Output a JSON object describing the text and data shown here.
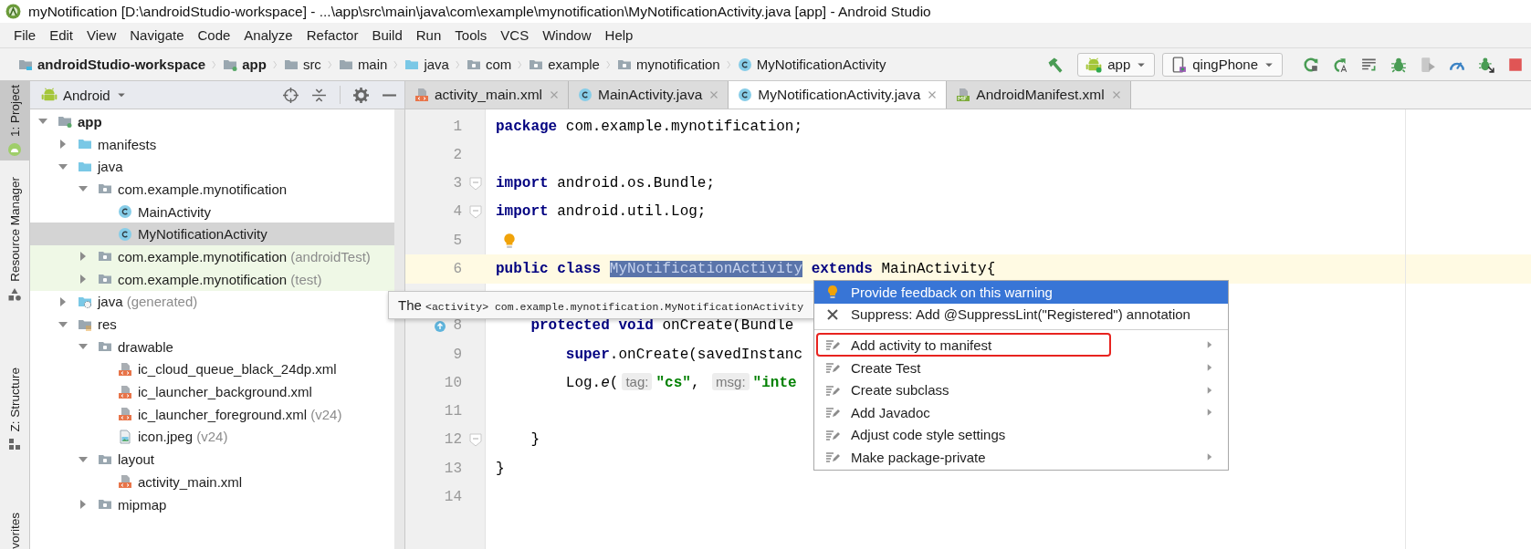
{
  "window": {
    "title": "myNotification [D:\\androidStudio-workspace] - ...\\app\\src\\main\\java\\com\\example\\mynotification\\MyNotificationActivity.java [app] - Android Studio"
  },
  "menu_bar": [
    "File",
    "Edit",
    "View",
    "Navigate",
    "Code",
    "Analyze",
    "Refactor",
    "Build",
    "Run",
    "Tools",
    "VCS",
    "Window",
    "Help"
  ],
  "breadcrumbs": [
    {
      "label": "androidStudio-workspace",
      "kind": "project"
    },
    {
      "label": "app",
      "kind": "module"
    },
    {
      "label": "src",
      "kind": "folder"
    },
    {
      "label": "main",
      "kind": "folder"
    },
    {
      "label": "java",
      "kind": "source"
    },
    {
      "label": "com",
      "kind": "package"
    },
    {
      "label": "example",
      "kind": "package"
    },
    {
      "label": "mynotification",
      "kind": "package"
    },
    {
      "label": "MyNotificationActivity",
      "kind": "class"
    }
  ],
  "run_config": {
    "label": "app"
  },
  "device": {
    "label": "qingPhone"
  },
  "tool_strip": [
    {
      "label": "1: Project",
      "kind": "android",
      "selected": true
    },
    {
      "label": "Resource Manager",
      "kind": "shapes",
      "selected": false
    },
    {
      "label": "Z: Structure",
      "kind": "structure",
      "selected": false
    },
    {
      "label": "vorites",
      "kind": "none",
      "selected": false
    }
  ],
  "project_panel": {
    "view": "Android",
    "tree": [
      {
        "label": "app",
        "kind": "module",
        "expanded": true,
        "selected": false,
        "test": false,
        "children": [
          {
            "label": "manifests",
            "kind": "source",
            "expanded": false,
            "selected": false,
            "test": false
          },
          {
            "label": "java",
            "kind": "source",
            "expanded": true,
            "selected": false,
            "test": false,
            "children": [
              {
                "label": "com.example.mynotification",
                "kind": "package",
                "expanded": true,
                "selected": false,
                "test": false,
                "children": [
                  {
                    "label": "MainActivity",
                    "kind": "class",
                    "selected": false,
                    "test": false
                  },
                  {
                    "label": "MyNotificationActivity",
                    "kind": "class",
                    "selected": true,
                    "test": false
                  }
                ]
              },
              {
                "label": "com.example.mynotification",
                "suffix": "(androidTest)",
                "kind": "package",
                "expanded": false,
                "selected": false,
                "test": true
              },
              {
                "label": "com.example.mynotification",
                "suffix": "(test)",
                "kind": "package",
                "expanded": false,
                "selected": false,
                "test": true
              }
            ]
          },
          {
            "label": "java",
            "suffix": "(generated)",
            "kind": "generated",
            "expanded": false,
            "selected": false,
            "test": false
          },
          {
            "label": "res",
            "kind": "res",
            "expanded": true,
            "selected": false,
            "test": false,
            "children": [
              {
                "label": "drawable",
                "kind": "package",
                "expanded": true,
                "selected": false,
                "test": false,
                "children": [
                  {
                    "label": "ic_cloud_queue_black_24dp.xml",
                    "kind": "xml",
                    "selected": false,
                    "test": false
                  },
                  {
                    "label": "ic_launcher_background.xml",
                    "kind": "xml",
                    "selected": false,
                    "test": false
                  },
                  {
                    "label": "ic_launcher_foreground.xml",
                    "suffix": "(v24)",
                    "kind": "xml",
                    "selected": false,
                    "test": false
                  },
                  {
                    "label": "icon.jpeg",
                    "suffix": "(v24)",
                    "kind": "image",
                    "selected": false,
                    "test": false
                  }
                ]
              },
              {
                "label": "layout",
                "kind": "package",
                "expanded": true,
                "selected": false,
                "test": false,
                "children": [
                  {
                    "label": "activity_main.xml",
                    "kind": "xml",
                    "selected": false,
                    "test": false
                  }
                ]
              },
              {
                "label": "mipmap",
                "kind": "package",
                "expanded": false,
                "selected": false,
                "test": false
              }
            ]
          }
        ]
      }
    ]
  },
  "editor": {
    "tabs": [
      {
        "label": "activity_main.xml",
        "kind": "xml",
        "selected": false
      },
      {
        "label": "MainActivity.java",
        "kind": "class",
        "selected": false
      },
      {
        "label": "MyNotificationActivity.java",
        "kind": "class",
        "selected": true
      },
      {
        "label": "AndroidManifest.xml",
        "kind": "manifest",
        "selected": false
      }
    ],
    "lines": [
      {
        "number": "1",
        "kind": "code",
        "current": false,
        "fold": false,
        "tokens": [
          {
            "text": "package",
            "kind": "keyword"
          },
          {
            "text": " com.example.mynotification;",
            "kind": "plain"
          }
        ]
      },
      {
        "number": "2",
        "kind": "code",
        "current": false,
        "fold": false
      },
      {
        "number": "3",
        "kind": "code",
        "current": false,
        "fold": true,
        "tokens": [
          {
            "text": "import",
            "kind": "keyword"
          },
          {
            "text": " android.os.Bundle;",
            "kind": "plain"
          }
        ]
      },
      {
        "number": "4",
        "kind": "code",
        "current": false,
        "fold": true,
        "tokens": [
          {
            "text": "import",
            "kind": "keyword"
          },
          {
            "text": " android.util.Log;",
            "kind": "plain"
          }
        ]
      },
      {
        "number": "5",
        "kind": "bulb",
        "current": false,
        "fold": false
      },
      {
        "number": "6",
        "kind": "code",
        "current": true,
        "fold": false,
        "tokens": [
          {
            "text": "public class ",
            "kind": "keyword"
          },
          {
            "text": "MyNotificationActivity",
            "kind": "selection"
          },
          {
            "text": " extends",
            "kind": "keyword"
          },
          {
            "text": " MainActivity{",
            "kind": "plain"
          }
        ]
      },
      {
        "kind": "code",
        "current": false
      },
      {
        "number": "8",
        "kind": "override",
        "current": false,
        "fold": false,
        "tokens": [
          {
            "text": "    protected",
            "kind": "keyword"
          },
          {
            "text": " void",
            "kind": "keyword"
          },
          {
            "text": " onCreate(Bundle",
            "kind": "plain"
          }
        ]
      },
      {
        "number": "9",
        "kind": "code",
        "current": false,
        "fold": false,
        "tokens": [
          {
            "text": "        super",
            "kind": "keyword"
          },
          {
            "text": ".onCreate(savedInstanc",
            "kind": "plain"
          }
        ]
      },
      {
        "number": "10",
        "kind": "code",
        "current": false,
        "fold": false,
        "tokens": [
          {
            "text": "        Log.",
            "kind": "plain"
          },
          {
            "text": "e",
            "kind": "italic"
          },
          {
            "text": "(",
            "kind": "plain"
          },
          {
            "text": "tag:",
            "kind": "hint"
          },
          {
            "text": "\"cs\"",
            "kind": "string"
          },
          {
            "text": ", ",
            "kind": "plain"
          },
          {
            "text": "msg:",
            "kind": "hint"
          },
          {
            "text": "\"inte",
            "kind": "string"
          }
        ]
      },
      {
        "number": "11",
        "kind": "code",
        "current": false,
        "fold": false
      },
      {
        "number": "12",
        "kind": "code",
        "current": false,
        "fold": true,
        "tokens": [
          {
            "text": "    }",
            "kind": "plain"
          }
        ]
      },
      {
        "number": "13",
        "kind": "code",
        "current": false,
        "fold": false,
        "tokens": [
          {
            "text": "}",
            "kind": "plain"
          }
        ]
      },
      {
        "number": "14",
        "kind": "code",
        "current": false,
        "fold": false
      }
    ],
    "tooltip": {
      "lead": "The",
      "code": "<activity> com.example.mynotification.MyNotificationActivity"
    },
    "popup_menu": {
      "sections": [
        {
          "items": [
            {
              "label": "Provide feedback on this warning",
              "kind": "bulb",
              "selected": true,
              "submenu": false,
              "annotated": false
            },
            {
              "label": "Suppress: Add @SuppressLint(\"Registered\") annotation",
              "kind": "cross",
              "selected": false,
              "submenu": false,
              "annotated": false
            }
          ]
        },
        {
          "items": [
            {
              "label": "Add activity to manifest",
              "kind": "intention",
              "selected": false,
              "submenu": true,
              "annotated": true
            },
            {
              "label": "Create Test",
              "kind": "intention",
              "selected": false,
              "submenu": true,
              "annotated": false
            },
            {
              "label": "Create subclass",
              "kind": "intention",
              "selected": false,
              "submenu": true,
              "annotated": false
            },
            {
              "label": "Add Javadoc",
              "kind": "intention",
              "selected": false,
              "submenu": true,
              "annotated": false
            },
            {
              "label": "Adjust code style settings",
              "kind": "intention",
              "selected": false,
              "submenu": false,
              "annotated": false
            },
            {
              "label": "Make package-private",
              "kind": "intention",
              "selected": false,
              "submenu": true,
              "annotated": false
            }
          ]
        }
      ]
    }
  }
}
